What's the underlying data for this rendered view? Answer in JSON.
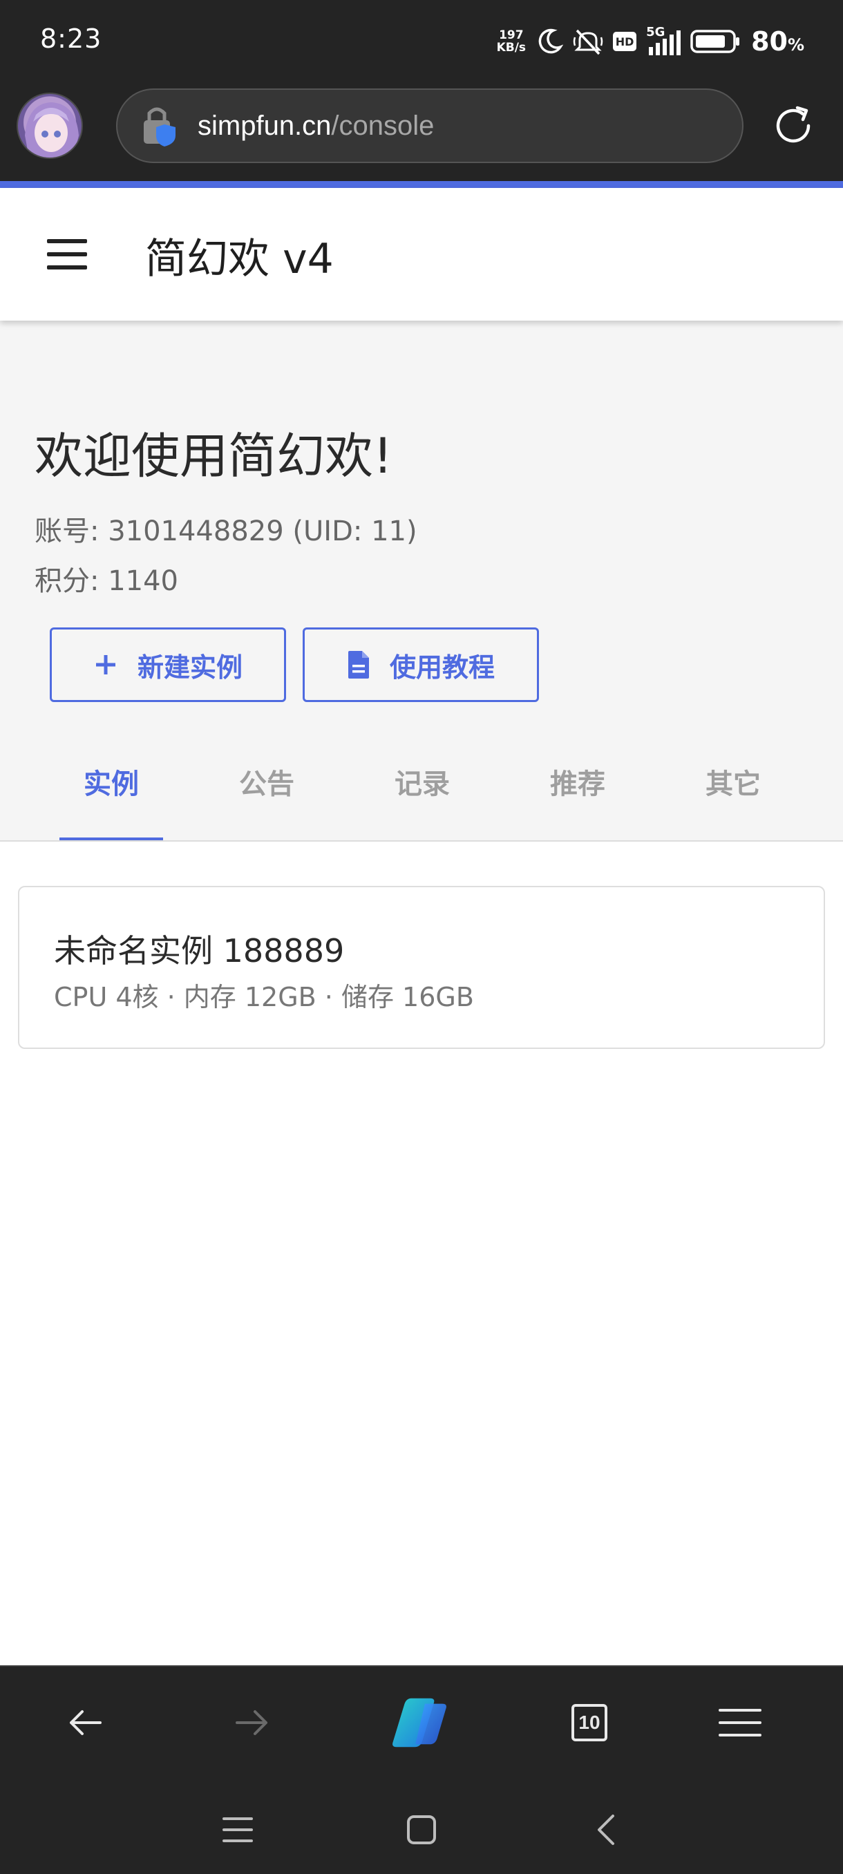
{
  "status_bar": {
    "time": "8:23",
    "net_speed_value": "197",
    "net_speed_unit": "KB/s",
    "hd_badge": "HD",
    "network_type": "5G",
    "battery_percent": "80",
    "battery_unit": "%",
    "icons": [
      "moon-icon",
      "mute-icon",
      "hd-icon",
      "signal-icon",
      "battery-icon"
    ]
  },
  "browser": {
    "url_domain": "simpfun.cn",
    "url_path": "/console",
    "tab_count": "10"
  },
  "header": {
    "title": "简幻欢 v4"
  },
  "welcome": {
    "title": "欢迎使用简幻欢!",
    "account": "账号: 3101448829 (UID: 11)",
    "points": "积分: 1140"
  },
  "actions": {
    "new_instance": "新建实例",
    "guide": "使用教程"
  },
  "tabs": [
    "实例",
    "公告",
    "记录",
    "推荐",
    "其它"
  ],
  "active_tab": "实例",
  "instances": [
    {
      "name": "未命名实例 188889",
      "specs": "CPU 4核 · 内存 12GB · 储存 16GB"
    }
  ],
  "colors": {
    "accent": "#4f6be0",
    "chrome": "#242424"
  }
}
